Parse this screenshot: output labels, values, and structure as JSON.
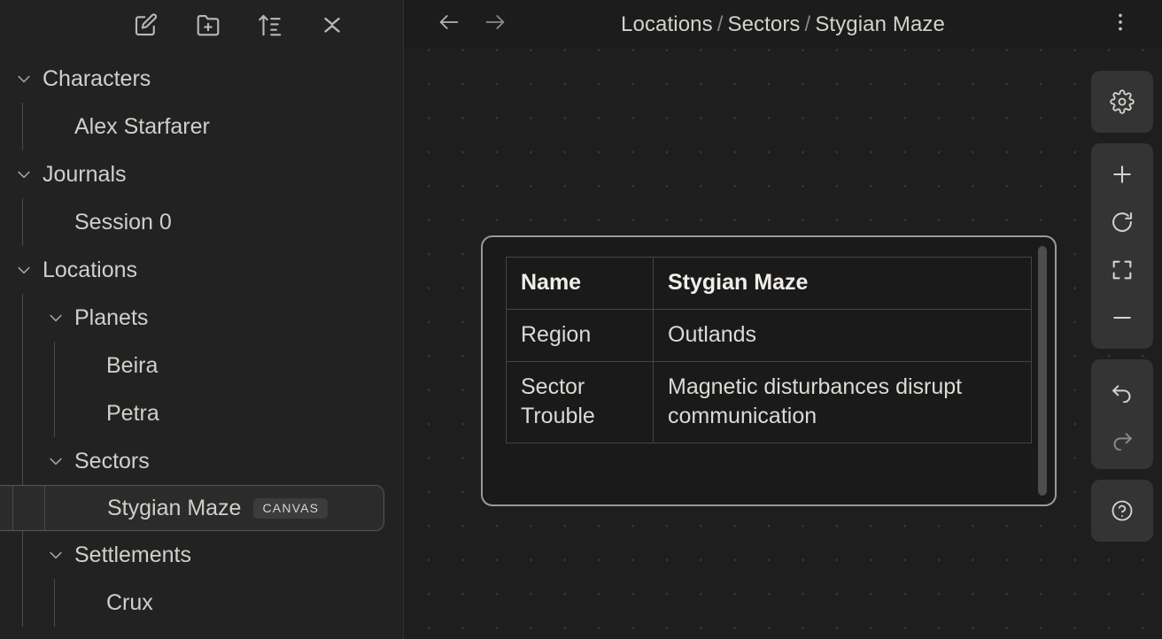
{
  "sidebar": {
    "toolbar": [
      {
        "name": "new-entry-icon",
        "label": "New Entry"
      },
      {
        "name": "new-folder-icon",
        "label": "New Folder"
      },
      {
        "name": "sort-ascending-icon",
        "label": "Sort"
      },
      {
        "name": "collapse-all-icon",
        "label": "Collapse All"
      }
    ],
    "tree": [
      {
        "label": "Characters",
        "depth": 0,
        "expanded": true,
        "type": "folder",
        "selected": false,
        "badge": ""
      },
      {
        "label": "Alex Starfarer",
        "depth": 1,
        "expanded": null,
        "type": "leaf",
        "selected": false,
        "badge": ""
      },
      {
        "label": "Journals",
        "depth": 0,
        "expanded": true,
        "type": "folder",
        "selected": false,
        "badge": ""
      },
      {
        "label": "Session 0",
        "depth": 1,
        "expanded": null,
        "type": "leaf",
        "selected": false,
        "badge": ""
      },
      {
        "label": "Locations",
        "depth": 0,
        "expanded": true,
        "type": "folder",
        "selected": false,
        "badge": ""
      },
      {
        "label": "Planets",
        "depth": 1,
        "expanded": true,
        "type": "folder",
        "selected": false,
        "badge": ""
      },
      {
        "label": "Beira",
        "depth": 2,
        "expanded": null,
        "type": "leaf",
        "selected": false,
        "badge": ""
      },
      {
        "label": "Petra",
        "depth": 2,
        "expanded": null,
        "type": "leaf",
        "selected": false,
        "badge": ""
      },
      {
        "label": "Sectors",
        "depth": 1,
        "expanded": true,
        "type": "folder",
        "selected": false,
        "badge": ""
      },
      {
        "label": "Stygian Maze",
        "depth": 2,
        "expanded": null,
        "type": "leaf",
        "selected": true,
        "badge": "CANVAS"
      },
      {
        "label": "Settlements",
        "depth": 1,
        "expanded": true,
        "type": "folder",
        "selected": false,
        "badge": ""
      },
      {
        "label": "Crux",
        "depth": 2,
        "expanded": null,
        "type": "leaf",
        "selected": false,
        "badge": ""
      }
    ]
  },
  "topbar": {
    "back_label": "Back",
    "forward_label": "Forward",
    "more_label": "More options",
    "breadcrumb": [
      "Locations",
      "Sectors",
      "Stygian Maze"
    ],
    "breadcrumb_separator": "/"
  },
  "canvas": {
    "card": {
      "title": "Stygian Maze",
      "rows": [
        {
          "key": "Name",
          "value": "Stygian Maze",
          "bold": true
        },
        {
          "key": "Region",
          "value": "Outlands",
          "bold": false
        },
        {
          "key": "Sector Trouble",
          "value": "Magnetic disturbances disrupt communication",
          "bold": false
        }
      ]
    }
  },
  "rail": {
    "groups": [
      {
        "buttons": [
          {
            "name": "gear-icon",
            "label": "Settings",
            "disabled": false
          }
        ]
      },
      {
        "buttons": [
          {
            "name": "plus-icon",
            "label": "Zoom In",
            "disabled": false
          },
          {
            "name": "reset-zoom-icon",
            "label": "Reset Zoom",
            "disabled": false
          },
          {
            "name": "fit-view-icon",
            "label": "Fit to View",
            "disabled": false
          },
          {
            "name": "minus-icon",
            "label": "Zoom Out",
            "disabled": false
          }
        ]
      },
      {
        "buttons": [
          {
            "name": "undo-icon",
            "label": "Undo",
            "disabled": false
          },
          {
            "name": "redo-icon",
            "label": "Redo",
            "disabled": true
          }
        ]
      },
      {
        "buttons": [
          {
            "name": "help-icon",
            "label": "Help",
            "disabled": false
          }
        ]
      }
    ]
  },
  "colors": {
    "sidebar_bg": "#222222",
    "canvas_bg": "#1e1e1e",
    "card_border": "#9a9a9a",
    "selection_border": "#575757",
    "text_primary": "#d5d2cd",
    "grid_dot": "#3a3a3a"
  }
}
